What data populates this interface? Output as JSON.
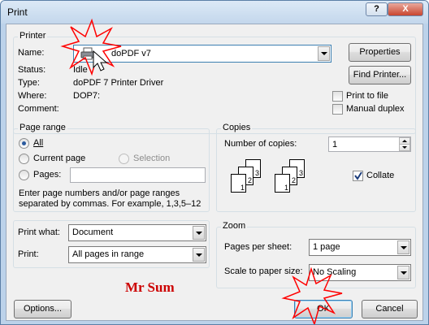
{
  "window": {
    "title": "Print"
  },
  "titlebar": {
    "help_label": "?",
    "close_label": "X"
  },
  "printer": {
    "group_label": "Printer",
    "name_label": "Name:",
    "name_value": "doPDF v7",
    "status_label": "Status:",
    "status_value": "Idle",
    "type_label": "Type:",
    "type_value": "doPDF 7 Printer Driver",
    "where_label": "Where:",
    "where_value": "DOP7:",
    "comment_label": "Comment:",
    "comment_value": "",
    "properties_label": "Properties",
    "find_printer_label": "Find Printer...",
    "print_to_file_label": "Print to file",
    "manual_duplex_label": "Manual duplex"
  },
  "page_range": {
    "group_label": "Page range",
    "all_label": "All",
    "current_page_label": "Current page",
    "selection_label": "Selection",
    "pages_label": "Pages:",
    "pages_value": "",
    "hint_line1": "Enter page numbers and/or page ranges",
    "hint_line2": "separated by commas.  For example, 1,3,5–12"
  },
  "copies": {
    "group_label": "Copies",
    "number_label": "Number of copies:",
    "number_value": "1",
    "collate_label": "Collate",
    "collate_checked": true,
    "page_numbers": [
      "3",
      "2",
      "1"
    ]
  },
  "print_what": {
    "label": "Print what:",
    "value": "Document"
  },
  "print": {
    "label": "Print:",
    "value": "All pages in range"
  },
  "zoom": {
    "group_label": "Zoom",
    "pages_per_sheet_label": "Pages per sheet:",
    "pages_per_sheet_value": "1 page",
    "scale_label": "Scale to paper size:",
    "scale_value": "No Scaling"
  },
  "annotation": {
    "text": "Mr Sum",
    "color": "#cc0000"
  },
  "buttons": {
    "options_label": "Options...",
    "ok_label": "OK",
    "cancel_label": "Cancel"
  },
  "icons": {
    "printer": "printer-icon",
    "cursor": "mouse-cursor-icon",
    "burst": "red-starburst-marker"
  },
  "colors": {
    "accent": "#3c7fb1",
    "selection_blue": "#3399ff",
    "marker_red": "#ff0000"
  }
}
